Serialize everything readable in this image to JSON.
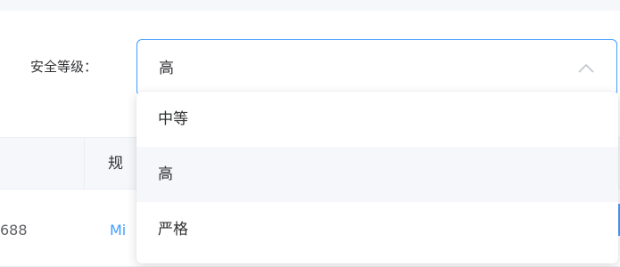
{
  "form": {
    "label": "安全等级：",
    "select": {
      "value": "高",
      "icon": "chevron-up-icon",
      "focus_color": "#409eff"
    }
  },
  "dropdown": {
    "options": [
      {
        "label": "中等"
      },
      {
        "label": "高"
      },
      {
        "label": "严格"
      }
    ]
  },
  "table": {
    "header": {
      "col2": "规"
    },
    "rows": [
      {
        "id": "688",
        "link": "Mi"
      }
    ]
  },
  "colors": {
    "accent": "#409eff",
    "header_bg": "#f5f7fa",
    "text": "#303133"
  }
}
